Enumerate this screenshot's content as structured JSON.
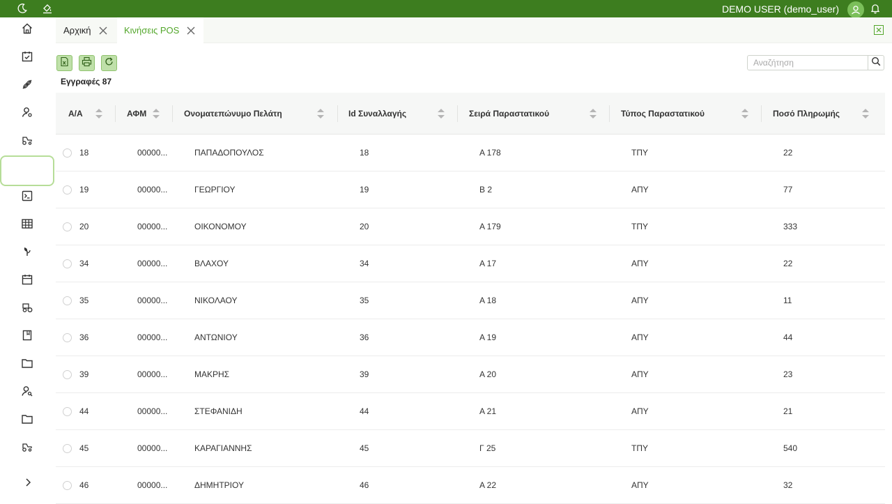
{
  "topbar": {
    "user_label": "DEMO USER (demo_user)",
    "icons": [
      "moon-icon",
      "paint-bucket-icon",
      "user-avatar-icon",
      "bell-icon"
    ],
    "bg_color": "#3d7d1f"
  },
  "sidebar": {
    "items": [
      {
        "icon": "home-icon"
      },
      {
        "icon": "calendar-check-icon"
      },
      {
        "icon": "seed-icon"
      },
      {
        "icon": "user-settings-icon"
      },
      {
        "icon": "tractor-icon"
      },
      {
        "icon": "blank-active-icon"
      },
      {
        "icon": "terminal-icon"
      },
      {
        "icon": "table-icon"
      },
      {
        "icon": "plant-icon"
      },
      {
        "icon": "calendar-icon"
      },
      {
        "icon": "tractor-front-icon"
      },
      {
        "icon": "book-icon"
      },
      {
        "icon": "folder-icon"
      },
      {
        "icon": "user-search-icon"
      },
      {
        "icon": "folder-open-icon"
      },
      {
        "icon": "tractor-side-icon"
      }
    ],
    "expand_icon": "chevron-right-icon"
  },
  "tabs": [
    {
      "label": "Αρχική"
    },
    {
      "label": "Κινήσεις POS"
    }
  ],
  "toolbar": {
    "export_excel_icon": "excel-icon",
    "print_icon": "printer-icon",
    "refresh_icon": "refresh-icon"
  },
  "records_label": "Εγγραφές 87",
  "search": {
    "placeholder": "Αναζήτηση",
    "value": ""
  },
  "table": {
    "columns": [
      "Α/Α",
      "ΑΦΜ",
      "Ονοματεπώνυμο Πελάτη",
      "Id Συναλλαγής",
      "Σειρά Παραστατικού",
      "Τύπος Παραστατικού",
      "Ποσό Πληρωμής"
    ],
    "rows": [
      [
        "18",
        "00000...",
        "ΠΑΠΑΔΟΠΟΥΛΟΣ",
        "18",
        "Α 178",
        "ΤΠΥ",
        "22"
      ],
      [
        "19",
        "00000...",
        "ΓΕΩΡΓΙΟΥ",
        "19",
        "Β 2",
        "ΑΠΥ",
        "77"
      ],
      [
        "20",
        "00000...",
        "ΟΙΚΟΝΟΜΟΥ",
        "20",
        "Α 179",
        "ΤΠΥ",
        "333"
      ],
      [
        "34",
        "00000...",
        "ΒΛΑΧΟΥ",
        "34",
        "Α 17",
        "ΑΠΥ",
        "22"
      ],
      [
        "35",
        "00000...",
        "ΝΙΚΟΛΑΟΥ",
        "35",
        "Α 18",
        "ΑΠΥ",
        "11"
      ],
      [
        "36",
        "00000...",
        "ΑΝΤΩΝΙΟΥ",
        "36",
        "Α 19",
        "ΑΠΥ",
        "44"
      ],
      [
        "39",
        "00000...",
        "ΜΑΚΡΗΣ",
        "39",
        "Α 20",
        "ΑΠΥ",
        "23"
      ],
      [
        "44",
        "00000...",
        "ΣΤΕΦΑΝΙΔΗ",
        "44",
        "Α 21",
        "ΑΠΥ",
        "21"
      ],
      [
        "45",
        "00000...",
        "ΚΑΡΑΓΙΑΝΝΗΣ",
        "45",
        "Γ 25",
        "ΤΠΥ",
        "540"
      ],
      [
        "46",
        "00000...",
        "ΔΗΜΗΤΡΙΟΥ",
        "46",
        "Α 22",
        "ΑΠΥ",
        "32"
      ]
    ]
  },
  "colors": {
    "accent": "#52a62a",
    "brand": "#3d7d1f"
  }
}
